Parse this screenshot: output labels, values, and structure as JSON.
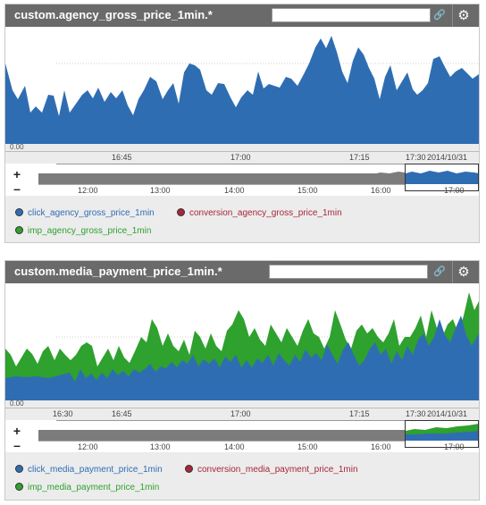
{
  "colors": {
    "blue": "#2f6db3",
    "green": "#2ea12e",
    "red": "#a8263a",
    "header": "#6a6a6a"
  },
  "panels": [
    {
      "title": "custom.agency_gross_price_1min.*",
      "search_value": "",
      "y_label": "0.00",
      "x_ticks": [
        "16:45",
        "17:00",
        "17:15",
        "17:30"
      ],
      "date_label": "2014/10/31",
      "nav_ticks": [
        "12:00",
        "13:00",
        "14:00",
        "15:00",
        "16:00",
        "17:00"
      ],
      "legend": [
        {
          "label": "click_agency_gross_price_1min",
          "color": "#2f6db3"
        },
        {
          "label": "conversion_agency_gross_price_1min",
          "color": "#a8263a"
        },
        {
          "label": "imp_agency_gross_price_1min",
          "color": "#2ea12e"
        }
      ]
    },
    {
      "title": "custom.media_payment_price_1min.*",
      "search_value": "",
      "y_label": "0.00",
      "x_ticks": [
        "16:30",
        "16:45",
        "17:00",
        "17:15",
        "17:30"
      ],
      "date_label": "2014/10/31",
      "nav_ticks": [
        "12:00",
        "13:00",
        "14:00",
        "15:00",
        "16:00",
        "17:00"
      ],
      "legend": [
        {
          "label": "click_media_payment_price_1min",
          "color": "#2f6db3"
        },
        {
          "label": "conversion_media_payment_price_1min",
          "color": "#a8263a"
        },
        {
          "label": "imp_media_payment_price_1min",
          "color": "#2ea12e"
        }
      ]
    }
  ]
}
